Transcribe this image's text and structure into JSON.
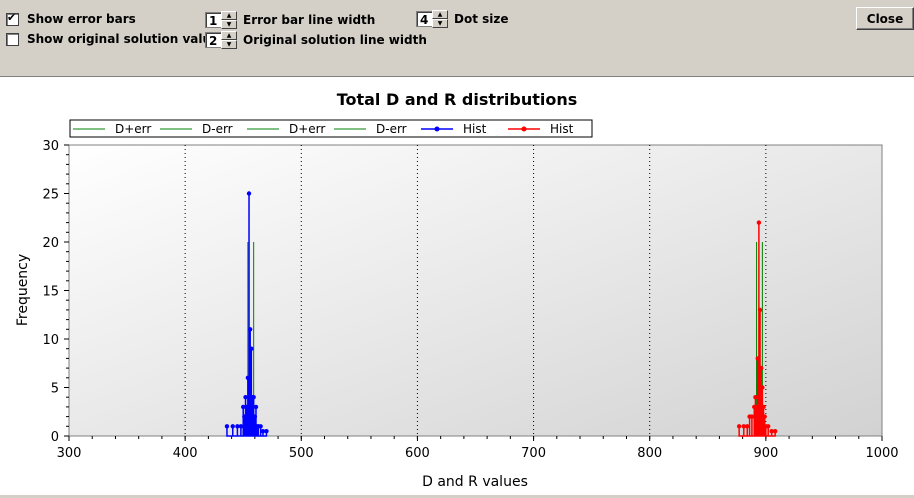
{
  "toolbar": {
    "show_error_bars": {
      "label": "Show error bars",
      "checked": true
    },
    "show_original": {
      "label": "Show original solution value",
      "checked": false
    },
    "error_bar_width": {
      "value": "1",
      "label": "Error bar line width"
    },
    "original_line_width": {
      "value": "2",
      "label": "Original solution line width"
    },
    "dot_size": {
      "value": "4",
      "label": "Dot size"
    },
    "close_label": "Close"
  },
  "chart_data": {
    "type": "line",
    "title": "Total D and R distributions",
    "xlabel": "D and R values",
    "ylabel": "Frequency",
    "xlim": [
      300,
      1000
    ],
    "ylim": [
      0,
      30
    ],
    "xticks": [
      300,
      400,
      500,
      600,
      700,
      800,
      900,
      1000
    ],
    "yticks": [
      0,
      5,
      10,
      15,
      20,
      25,
      30
    ],
    "grid": "vertical dotted",
    "legend_position": "top",
    "legend": [
      {
        "name": "D+err",
        "color": "#008000",
        "marker": false
      },
      {
        "name": "D-err",
        "color": "#008000",
        "marker": false
      },
      {
        "name": "D+err",
        "color": "#008000",
        "marker": false
      },
      {
        "name": "D-err",
        "color": "#008000",
        "marker": false
      },
      {
        "name": "Hist",
        "color": "#0000ff",
        "marker": true
      },
      {
        "name": "Hist",
        "color": "#ff0000",
        "marker": true
      }
    ],
    "series": [
      {
        "name": "D+err",
        "color": "#008000",
        "style": "vline",
        "x": [
          459
        ],
        "y": [
          20
        ]
      },
      {
        "name": "D-err",
        "color": "#008000",
        "style": "vline",
        "x": [
          454
        ],
        "y": [
          20
        ]
      },
      {
        "name": "D+err",
        "color": "#008000",
        "style": "vline",
        "x": [
          897
        ],
        "y": [
          20
        ]
      },
      {
        "name": "D-err",
        "color": "#008000",
        "style": "vline",
        "x": [
          892
        ],
        "y": [
          20
        ]
      },
      {
        "name": "Hist",
        "color": "#0000ff",
        "style": "stick",
        "x": [
          436,
          441,
          445,
          448,
          450,
          451,
          452,
          453,
          454,
          455,
          456,
          457,
          458,
          459,
          460,
          461,
          462,
          463,
          465,
          467,
          470
        ],
        "y": [
          1,
          1,
          1,
          1,
          3,
          2,
          4,
          3,
          6,
          25,
          11,
          9,
          4,
          4,
          2,
          3,
          1,
          1,
          1,
          0.5,
          0.5
        ]
      },
      {
        "name": "Hist",
        "color": "#ff0000",
        "style": "stick",
        "x": [
          877,
          881,
          884,
          886,
          888,
          890,
          891,
          892,
          893,
          894,
          895,
          896,
          897,
          898,
          899,
          900,
          902,
          905,
          908
        ],
        "y": [
          1,
          1,
          1,
          2,
          2,
          3,
          4,
          3,
          8,
          22,
          13,
          7,
          5,
          3,
          2,
          1,
          1,
          0.5,
          0.5
        ]
      }
    ]
  }
}
